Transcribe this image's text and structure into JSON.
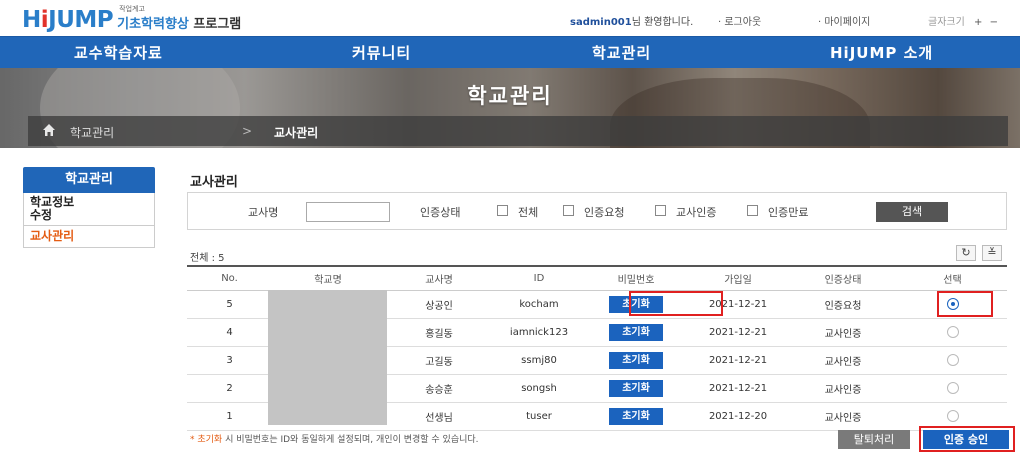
{
  "header": {
    "logo_brand_h": "H",
    "logo_brand_i": "i",
    "logo_brand_jump": "JUMP",
    "logo_small": "작업계고",
    "logo_prog_a": "기초학력향상",
    "logo_prog_b": " 프로그램",
    "user_id": "sadmin001",
    "welcome": "님 환영합니다.",
    "logout": "· 로그아웃",
    "mypage": "· 마이페이지",
    "font_size_label": "글자크기",
    "font_plus": "+",
    "font_minus": "−"
  },
  "nav": {
    "items": [
      {
        "label": "교수학습자료"
      },
      {
        "label": "커뮤니티"
      },
      {
        "label": "학교관리"
      },
      {
        "label": "HiJUMP 소개"
      }
    ]
  },
  "banner": {
    "title": "학교관리",
    "breadcrumb_1": "학교관리",
    "breadcrumb_sep": ">",
    "breadcrumb_2": "교사관리"
  },
  "sidebar": {
    "header": "학교관리",
    "item_1_line1": "학교정보",
    "item_1_line2": "수정",
    "item_2": "교사관리"
  },
  "content": {
    "title": "교사관리",
    "search": {
      "teacher_label": "교사명",
      "teacher_value": "",
      "status_label": "인증상태",
      "opt_all": "전체",
      "opt_request": "인증요청",
      "opt_teacher": "교사인증",
      "opt_done": "인증만료",
      "search_button": "검색"
    },
    "total": "전체 : 5",
    "refresh_icon": "↻",
    "download_icon": "≚",
    "table": {
      "headers": [
        "No.",
        "학교명",
        "교사명",
        "ID",
        "비밀번호",
        "가입일",
        "인증상태",
        "선택"
      ],
      "rows": [
        {
          "no": "5",
          "school": "",
          "name": "상공인",
          "id": "kocham",
          "pw": "초기화",
          "date": "2021-12-21",
          "status": "인증요청",
          "selected": true
        },
        {
          "no": "4",
          "school": "",
          "name": "홍길동",
          "id": "iamnick123",
          "pw": "초기화",
          "date": "2021-12-21",
          "status": "교사인증",
          "selected": false
        },
        {
          "no": "3",
          "school": "",
          "name": "고길동",
          "id": "ssmj80",
          "pw": "초기화",
          "date": "2021-12-21",
          "status": "교사인증",
          "selected": false
        },
        {
          "no": "2",
          "school": "",
          "name": "송승훈",
          "id": "songsh",
          "pw": "초기화",
          "date": "2021-12-21",
          "status": "교사인증",
          "selected": false
        },
        {
          "no": "1",
          "school": "",
          "name": "선생님",
          "id": "tuser",
          "pw": "초기화",
          "date": "2021-12-20",
          "status": "교사인증",
          "selected": false
        }
      ]
    },
    "note_highlight": "* 초기화",
    "note_text": " 시 비밀번호는 ID와 동일하게 설정되며, 개인이 변경할 수 있습니다.",
    "withdraw_button": "탈퇴처리",
    "approve_button": "인증 승인"
  },
  "colors": {
    "nav": "#2066b8",
    "accent_orange": "#e45c13",
    "button_blue": "#1b63be",
    "highlight_red": "#e02020"
  }
}
